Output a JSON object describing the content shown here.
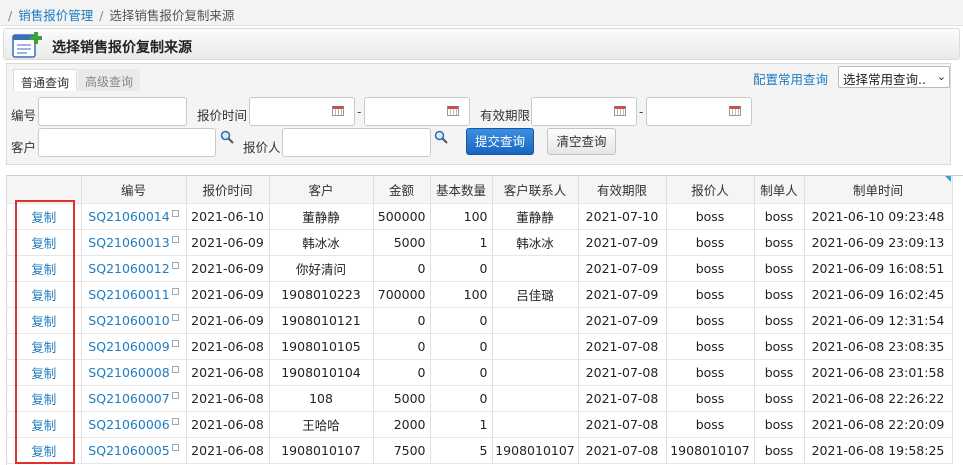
{
  "breadcrumb": {
    "items": [
      "销售报价管理",
      "选择销售报价复制来源"
    ]
  },
  "title": "选择销售报价复制来源",
  "query": {
    "tabs": [
      "普通查询",
      "高级查询"
    ],
    "config_link": "配置常用查询",
    "common_select": "选择常用查询..",
    "fields": {
      "code_label": "编号",
      "quote_time_label": "报价时间",
      "valid_label": "有效期限",
      "customer_label": "客户",
      "quoter_label": "报价人"
    },
    "dash": "-",
    "submit_label": "提交查询",
    "clear_label": "清空查询"
  },
  "table": {
    "columns": [
      "",
      "编号",
      "报价时间",
      "客户",
      "金额",
      "基本数量",
      "客户联系人",
      "有效期限",
      "报价人",
      "制单人",
      "制单时间"
    ],
    "copy_label": "复制",
    "rows": [
      [
        "SQ21060014",
        "2021-06-10",
        "董静静",
        "500000",
        "100",
        "董静静",
        "2021-07-10",
        "boss",
        "boss",
        "2021-06-10 09:23:48"
      ],
      [
        "SQ21060013",
        "2021-06-09",
        "韩冰冰",
        "5000",
        "1",
        "韩冰冰",
        "2021-07-09",
        "boss",
        "boss",
        "2021-06-09 23:09:13"
      ],
      [
        "SQ21060012",
        "2021-06-09",
        "你好清问",
        "0",
        "0",
        "",
        "2021-07-09",
        "boss",
        "boss",
        "2021-06-09 16:08:51"
      ],
      [
        "SQ21060011",
        "2021-06-09",
        "1908010223",
        "700000",
        "100",
        "吕佳璐",
        "2021-07-09",
        "boss",
        "boss",
        "2021-06-09 16:02:45"
      ],
      [
        "SQ21060010",
        "2021-06-09",
        "1908010121",
        "0",
        "0",
        "",
        "2021-07-09",
        "boss",
        "boss",
        "2021-06-09 12:31:54"
      ],
      [
        "SQ21060009",
        "2021-06-08",
        "1908010105",
        "0",
        "0",
        "",
        "2021-07-08",
        "boss",
        "boss",
        "2021-06-08 23:08:35"
      ],
      [
        "SQ21060008",
        "2021-06-08",
        "1908010104",
        "0",
        "0",
        "",
        "2021-07-08",
        "boss",
        "boss",
        "2021-06-08 23:01:58"
      ],
      [
        "SQ21060007",
        "2021-06-08",
        "108",
        "5000",
        "0",
        "",
        "2021-07-08",
        "boss",
        "boss",
        "2021-06-08 22:26:22"
      ],
      [
        "SQ21060006",
        "2021-06-08",
        "王哈哈",
        "2000",
        "1",
        "",
        "2021-07-08",
        "boss",
        "boss",
        "2021-06-08 22:20:09"
      ],
      [
        "SQ21060005",
        "2021-06-08",
        "1908010107",
        "7500",
        "5",
        "1908010107",
        "2021-07-08",
        "1908010107",
        "boss",
        "2021-06-08 19:58:25"
      ]
    ]
  },
  "colors": {
    "link": "#1f7bc0",
    "highlight_box": "#e03030",
    "submit_button": "#1a66c2"
  }
}
